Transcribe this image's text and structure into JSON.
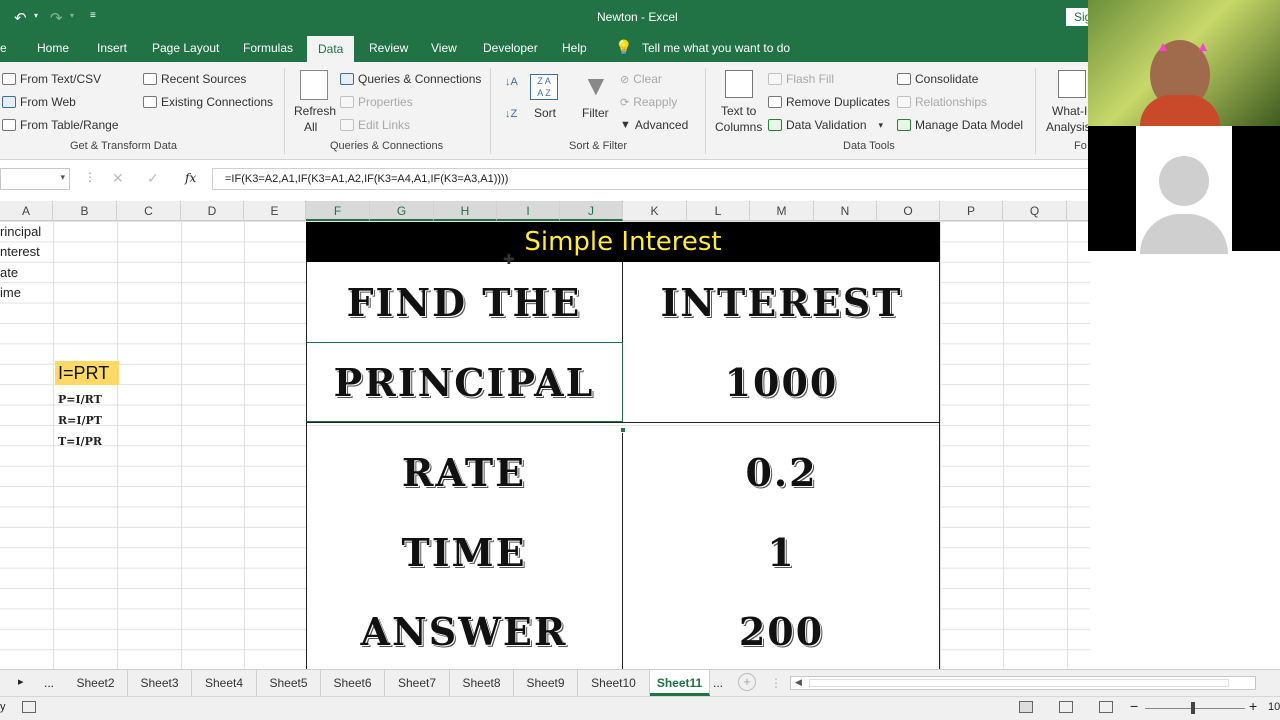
{
  "titlebar": {
    "title": "Newton  -  Excel",
    "signin": "Sig"
  },
  "ribbon_tabs": [
    "e",
    "Home",
    "Insert",
    "Page Layout",
    "Formulas",
    "Data",
    "Review",
    "View",
    "Developer",
    "Help"
  ],
  "tell_me": "Tell me what you want to do",
  "get_transform": {
    "from_text": "From Text/CSV",
    "from_web": "From Web",
    "from_table": "From Table/Range",
    "recent": "Recent Sources",
    "existing": "Existing Connections",
    "group": "Get & Transform Data"
  },
  "queries": {
    "refresh": "Refresh",
    "refresh_all": "All",
    "qc": "Queries & Connections",
    "properties": "Properties",
    "edit_links": "Edit Links",
    "group": "Queries & Connections"
  },
  "sort_filter": {
    "sort": "Sort",
    "filter": "Filter",
    "clear": "Clear",
    "reapply": "Reapply",
    "advanced": "Advanced",
    "group": "Sort & Filter"
  },
  "data_tools": {
    "text_to": "Text to",
    "columns": "Columns",
    "flash_fill": "Flash Fill",
    "remove_dup": "Remove Duplicates",
    "validation": "Data Validation",
    "consolidate": "Consolidate",
    "relationships": "Relationships",
    "manage_model": "Manage Data Model",
    "group": "Data Tools"
  },
  "forecast": {
    "what_if": "What-I",
    "analysis": "Analysis",
    "group": "Fo"
  },
  "formula_bar": {
    "fx": "fx",
    "formula": "=IF(K3=A2,A1,IF(K3=A1,A2,IF(K3=A4,A1,IF(K3=A3,A1))))"
  },
  "columns": [
    "A",
    "B",
    "C",
    "D",
    "E",
    "F",
    "G",
    "H",
    "I",
    "J",
    "K",
    "L",
    "M",
    "N",
    "O",
    "P",
    "Q"
  ],
  "col_a_values": [
    "rincipal",
    "nterest",
    "ate",
    "ime"
  ],
  "formulas": {
    "main": "I=PRT",
    "p": "P=I/RT",
    "r": "R=I/PT",
    "t": "T=I/PR"
  },
  "table": {
    "title": "Simple Interest",
    "rows": [
      {
        "left": "FIND THE",
        "right": "INTEREST"
      },
      {
        "left": "PRINCIPAL",
        "right": "1000"
      },
      {
        "left": "RATE",
        "right": "0.2"
      },
      {
        "left": "TIME",
        "right": "1"
      },
      {
        "left": "ANSWER",
        "right": "200"
      }
    ]
  },
  "sheets": [
    "Sheet2",
    "Sheet3",
    "Sheet4",
    "Sheet5",
    "Sheet6",
    "Sheet7",
    "Sheet8",
    "Sheet9",
    "Sheet10",
    "Sheet11"
  ],
  "sheet_nav": {
    "prev": "▸",
    "more_left": "...",
    "more_right": "...",
    "add": "+"
  },
  "status": {
    "zoom": "10",
    "mode": "y"
  }
}
